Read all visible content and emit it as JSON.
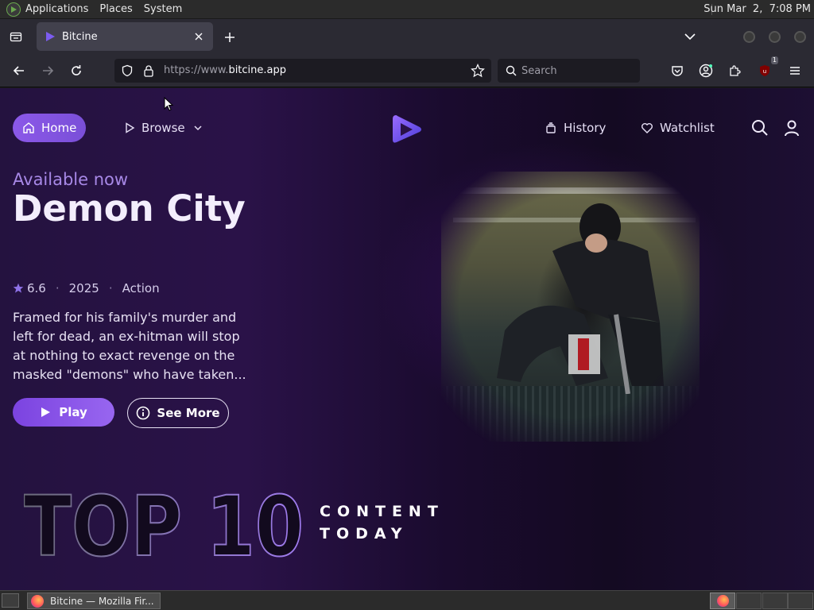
{
  "os_panel": {
    "menus": [
      "Applications",
      "Places",
      "System"
    ],
    "clock": "Sun Mar  2,  7:08 PM"
  },
  "browser": {
    "tab": {
      "title": "Bitcine"
    },
    "url": {
      "prefix": "https://www.",
      "host": "bitcine.app"
    },
    "search": {
      "placeholder": "Search"
    },
    "extension_badge": "1"
  },
  "site": {
    "nav": {
      "home": "Home",
      "browse": "Browse",
      "history": "History",
      "watchlist": "Watchlist"
    },
    "hero": {
      "eyebrow": "Available now",
      "title": "Demon City",
      "rating": "6.6",
      "year": "2025",
      "genre": "Action",
      "description": "Framed for his family's murder and left for dead, an ex-hitman will stop at nothing to exact revenge on the masked \"demons\" who have taken...",
      "play_label": "Play",
      "more_label": "See More"
    },
    "top10": {
      "big": "TOP 10",
      "line1": "CONTENT",
      "line2": "TODAY"
    },
    "colors": {
      "accent": "#8b58e8",
      "accent_text": "#a788e6",
      "background": "#1a0b2e"
    }
  },
  "taskbar": {
    "window_title": "Bitcine — Mozilla Fir..."
  }
}
